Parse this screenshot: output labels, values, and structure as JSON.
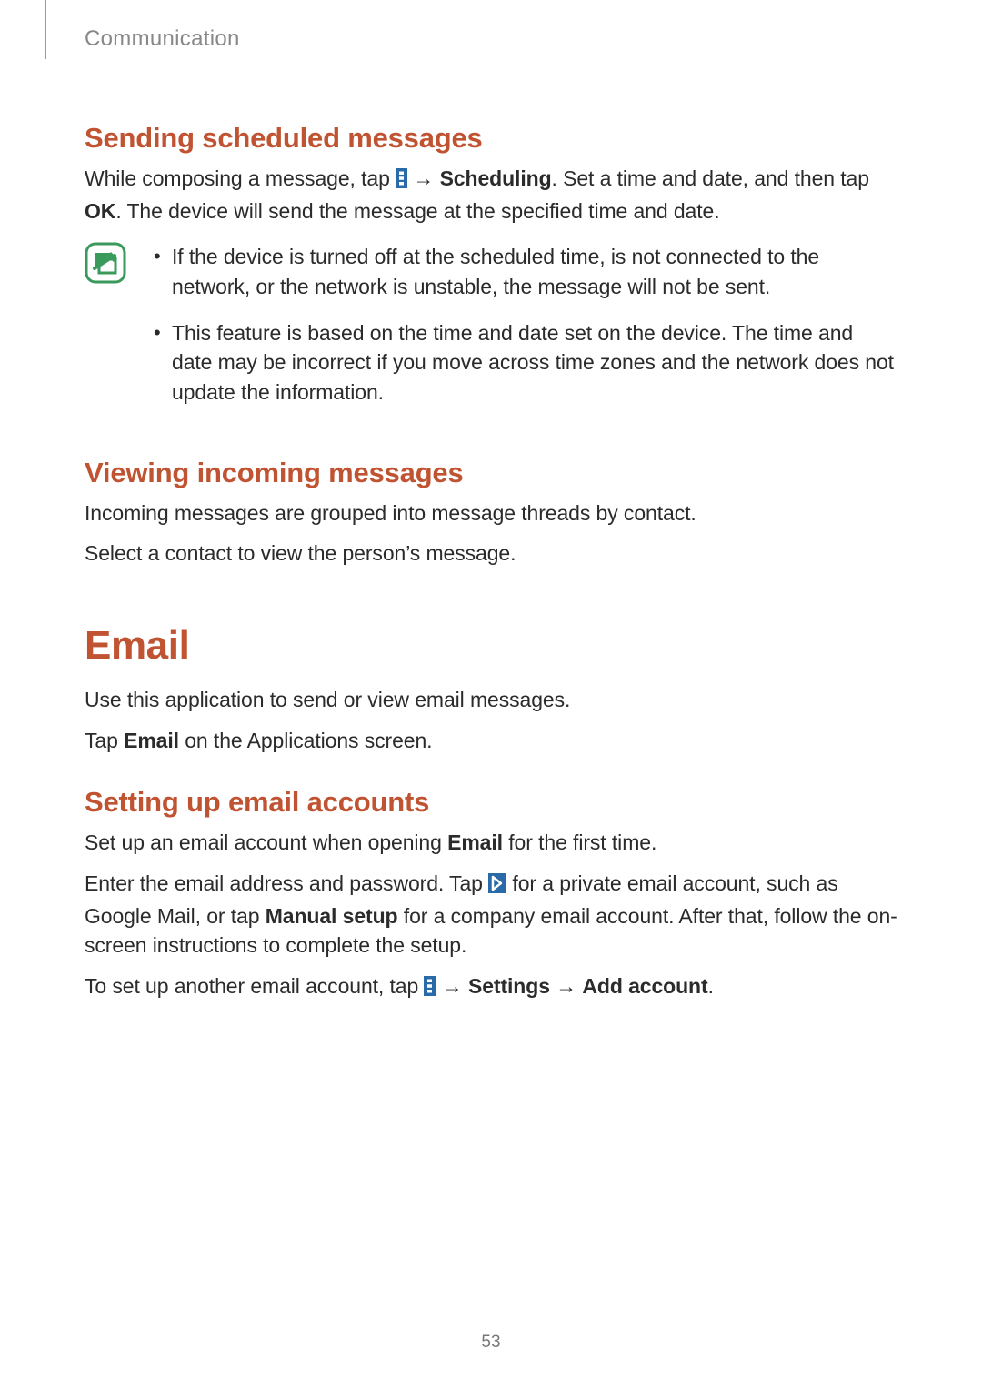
{
  "header": {
    "section_label": "Communication"
  },
  "section1": {
    "heading": "Sending scheduled messages",
    "p1_a": "While composing a message, tap ",
    "p1_arrow": " → ",
    "p1_bold1": "Scheduling",
    "p1_b": ". Set a time and date, and then tap ",
    "p1_bold2": "OK",
    "p1_c": ". The device will send the message at the specified time and date.",
    "note1": "If the device is turned off at the scheduled time, is not connected to the network, or the network is unstable, the message will not be sent.",
    "note2": "This feature is based on the time and date set on the device. The time and date may be incorrect if you move across time zones and the network does not update the information."
  },
  "section2": {
    "heading": "Viewing incoming messages",
    "p1": "Incoming messages are grouped into message threads by contact.",
    "p2": "Select a contact to view the person’s message."
  },
  "chapter": {
    "heading": "Email",
    "p1": "Use this application to send or view email messages.",
    "p2_a": "Tap ",
    "p2_bold": "Email",
    "p2_b": " on the Applications screen."
  },
  "section3": {
    "heading": "Setting up email accounts",
    "p1_a": "Set up an email account when opening ",
    "p1_bold": "Email",
    "p1_b": " for the first time.",
    "p2_a": "Enter the email address and password. Tap ",
    "p2_b": " for a private email account, such as Google Mail, or tap ",
    "p2_bold": "Manual setup",
    "p2_c": " for a company email account. After that, follow the on-screen instructions to complete the setup.",
    "p3_a": "To set up another email account, tap ",
    "p3_arrow1": " → ",
    "p3_bold1": "Settings",
    "p3_arrow2": " → ",
    "p3_bold2": "Add account",
    "p3_b": "."
  },
  "page_number": "53"
}
